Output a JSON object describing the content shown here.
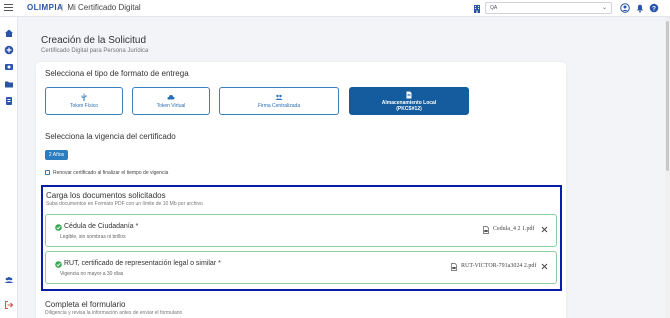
{
  "header": {
    "logo": "OLIMPIA",
    "separator": "|",
    "app_title": "Mi Certificado Digital",
    "env_value": "QA"
  },
  "page": {
    "title": "Creación de la Solicitud",
    "subtitle": "Certificado Digital para Persona Jurídica"
  },
  "format": {
    "title": "Selecciona el tipo de formato de entrega",
    "options": [
      {
        "label": "Token Físico",
        "icon": "usb-icon",
        "selected": false
      },
      {
        "label": "Token Virtual",
        "icon": "cloud-icon",
        "selected": false
      },
      {
        "label": "Firma Centralizada",
        "icon": "users-icon",
        "selected": false
      },
      {
        "label_line1": "Almacenamiento Local",
        "label_line2": "(PKCS#12)",
        "icon": "document-icon",
        "selected": true
      }
    ]
  },
  "validity": {
    "title": "Selecciona la vigencia del certificado",
    "option": "2 Años",
    "renew_label": "Renovar certificado al finalizar el tiempo de vigencia"
  },
  "documents": {
    "title": "Carga los documentos solicitados",
    "subtitle": "Suba documentos en Formato PDF con un límite de 10 Mb por archivo",
    "items": [
      {
        "name": "Cédula de Ciudadanía *",
        "note": "Legible, sin sombras ni brillos",
        "file": "Cedula_4 2 1.pdf"
      },
      {
        "name": "RUT, certificado de representación legal o similar *",
        "note": "Vigencia no mayor a 30 días",
        "file": "RUT-VICTOR-791a3024 2.pdf"
      }
    ]
  },
  "form": {
    "title": "Completa el formulario",
    "subtitle": "Diligencia y revisa la información antes de enviar el formulario"
  },
  "colors": {
    "primary": "#2c7cc0",
    "selected": "#155c9e",
    "success": "#3aa655",
    "highlight": "#0a1da8"
  }
}
